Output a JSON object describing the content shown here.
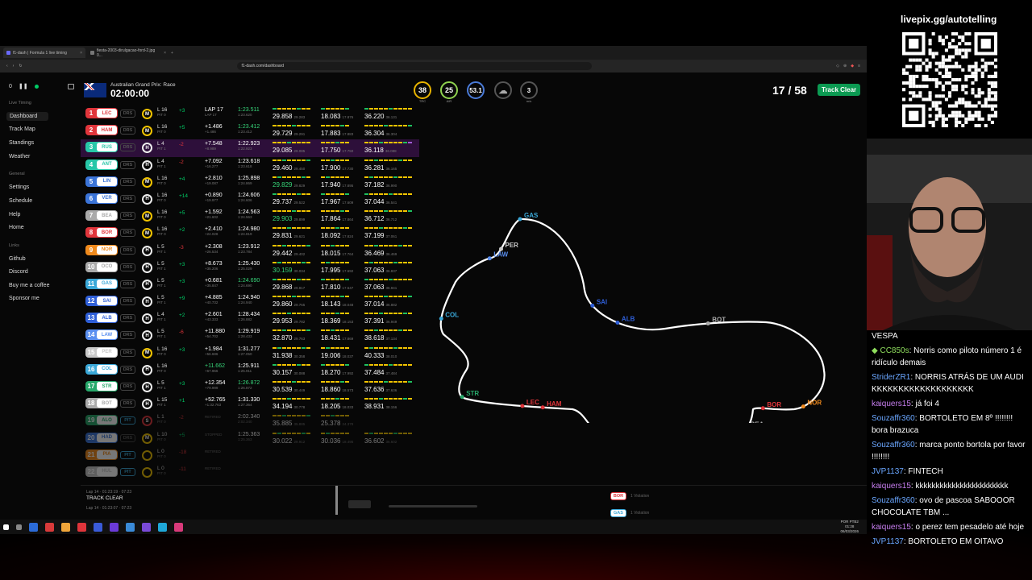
{
  "browser": {
    "tabs": [
      {
        "label": "f1-dash | Formula 1 live timing"
      },
      {
        "label": "fiesta-2003-dirulgacao-ford-2.jpg 0..."
      }
    ],
    "url": "f1-dash.com/dashboard"
  },
  "sidebar": {
    "counter": "0",
    "group_live": "Live Timing",
    "items_live": [
      {
        "label": "Dashboard"
      },
      {
        "label": "Track Map"
      },
      {
        "label": "Standings"
      },
      {
        "label": "Weather"
      }
    ],
    "group_general": "General",
    "items_general": [
      {
        "label": "Settings"
      },
      {
        "label": "Schedule"
      },
      {
        "label": "Help"
      },
      {
        "label": "Home"
      }
    ],
    "group_links": "Links",
    "items_links": [
      {
        "label": "Github"
      },
      {
        "label": "Discord"
      },
      {
        "label": "Buy me a coffee"
      },
      {
        "label": "Sponsor me"
      }
    ]
  },
  "header": {
    "gp_name": "Australian Grand Prix: Race",
    "clock": "02:00:00",
    "weather": [
      {
        "value": "38",
        "unit": "TRC",
        "color": "#e8b400"
      },
      {
        "value": "25",
        "unit": "AIR",
        "color": "#8fd14f"
      },
      {
        "value": "53.1",
        "unit": "",
        "color": "#4a7bd8"
      }
    ],
    "wind": "3",
    "wind_unit": "m/s",
    "lap_counter": "17 / 58",
    "track_status": "Track Clear"
  },
  "drivers": [
    {
      "pos": "1",
      "tla": "LEC",
      "color": "#e0353b",
      "drs": "DRS",
      "tyre": "M",
      "tc": "m",
      "laps": "L 16",
      "pit": "PIT 0",
      "pm": "+3",
      "gap": "LAP 17",
      "gapsub": "LAP 17",
      "lt": "1:23.511",
      "ltsub": "1:23.620",
      "ltg": "g",
      "s1": "29.858",
      "s1s": "29.283",
      "s2": "18.083",
      "s2s": "17.876",
      "s3": "36.220",
      "s3s": "36.131",
      "hl": false,
      "dim": false
    },
    {
      "pos": "2",
      "tla": "HAM",
      "color": "#e0353b",
      "drs": "DRS",
      "tyre": "M",
      "tc": "m",
      "laps": "L 16",
      "pit": "PIT 0",
      "pm": "+5",
      "gap": "+1.486",
      "gapsub": "+1.486",
      "lt": "1:23.412",
      "ltsub": "1:23.412",
      "ltg": "g",
      "s1": "29.729",
      "s1s": "29.291",
      "s2": "17.883",
      "s2s": "17.883",
      "s3": "36.304",
      "s3s": "36.304",
      "hl": false,
      "dim": false
    },
    {
      "pos": "3",
      "tla": "RUS",
      "color": "#27c7a8",
      "drs": "DRS",
      "tyre": "H",
      "tc": "h",
      "laps": "L 4",
      "pit": "PIT 1",
      "pm": "-2",
      "gap": "+7.548",
      "gapsub": "+8.989",
      "lt": "1:22.923",
      "ltsub": "1:22.923",
      "ltg": "",
      "s1": "29.085",
      "s1s": "29.085",
      "s2": "17.750",
      "s2s": "17.750",
      "s3": "36.118",
      "s3s": "36.088",
      "hl": true,
      "dim": false
    },
    {
      "pos": "4",
      "tla": "ANT",
      "color": "#27c7a8",
      "drs": "DRS",
      "tyre": "H",
      "tc": "h",
      "laps": "L 4",
      "pit": "PIT 1",
      "pm": "-2",
      "gap": "+7.092",
      "gapsub": "+16.277",
      "lt": "1:23.618",
      "ltsub": "1:23.618",
      "ltg": "",
      "s1": "29.460",
      "s1s": "29.450",
      "s2": "17.900",
      "s2s": "17.730",
      "s3": "36.281",
      "s3s": "36.165",
      "hl": false,
      "dim": false
    },
    {
      "pos": "5",
      "tla": "LIN",
      "color": "#3b74d8",
      "drs": "DRS",
      "tyre": "M",
      "tc": "m",
      "laps": "L 16",
      "pit": "PIT 0",
      "pm": "+4",
      "gap": "+2.810",
      "gapsub": "+19.087",
      "lt": "1:25.898",
      "ltsub": "1:24.869",
      "ltg": "",
      "s1": "29.829",
      "s1s": "29.829",
      "s2": "17.940",
      "s2s": "17.895",
      "s3": "37.182",
      "s3s": "36.990",
      "hl": false,
      "dim": false
    },
    {
      "pos": "6",
      "tla": "VER",
      "color": "#3b74d8",
      "drs": "DRS",
      "tyre": "H",
      "tc": "h",
      "laps": "L 16",
      "pit": "PIT 0",
      "pm": "+14",
      "gap": "+0.890",
      "gapsub": "+19.977",
      "lt": "1:24.606",
      "ltsub": "1:24.606",
      "ltg": "",
      "s1": "29.737",
      "s1s": "29.522",
      "s2": "17.967",
      "s2s": "17.609",
      "s3": "37.044",
      "s3s": "36.541",
      "hl": false,
      "dim": false
    },
    {
      "pos": "7",
      "tla": "BEA",
      "color": "#aaaaaa",
      "drs": "DRS",
      "tyre": "M",
      "tc": "m",
      "laps": "L 16",
      "pit": "PIT 0",
      "pm": "+5",
      "gap": "+1.592",
      "gapsub": "+21.602",
      "lt": "1:24.563",
      "ltsub": "1:24.563",
      "ltg": "",
      "s1": "29.903",
      "s1s": "29.899",
      "s2": "17.864",
      "s2s": "17.864",
      "s3": "36.712",
      "s3s": "36.712",
      "hl": false,
      "dim": false
    },
    {
      "pos": "8",
      "tla": "BOR",
      "color": "#e0353b",
      "drs": "DRS",
      "tyre": "M",
      "tc": "m",
      "laps": "L 16",
      "pit": "PIT 0",
      "pm": "+2",
      "gap": "+2.410",
      "gapsub": "+24.028",
      "lt": "1:24.980",
      "ltsub": "1:24.819",
      "ltg": "",
      "s1": "29.831",
      "s1s": "29.621",
      "s2": "18.092",
      "s2s": "17.824",
      "s3": "37.199",
      "s3s": "37.061",
      "hl": false,
      "dim": false
    },
    {
      "pos": "9",
      "tla": "NOR",
      "color": "#f08a1c",
      "drs": "DRS",
      "tyre": "H",
      "tc": "h",
      "laps": "L 5",
      "pit": "PIT 1",
      "pm": "-3",
      "gap": "+2.308",
      "gapsub": "+26.534",
      "lt": "1:23.912",
      "ltsub": "1:23.784",
      "ltg": "",
      "s1": "29.442",
      "s1s": "29.402",
      "s2": "18.015",
      "s2s": "17.764",
      "s3": "36.469",
      "s3s": "36.469",
      "hl": false,
      "dim": false
    },
    {
      "pos": "10",
      "tla": "OCO",
      "color": "#aaaaaa",
      "drs": "DRS",
      "tyre": "H",
      "tc": "h",
      "laps": "L 5",
      "pit": "PIT 1",
      "pm": "+3",
      "gap": "+8.673",
      "gapsub": "+35.206",
      "lt": "1:25.430",
      "ltsub": "1:25.029",
      "ltg": "",
      "s1": "30.159",
      "s1s": "30.034",
      "s2": "17.995",
      "s2s": "17.692",
      "s3": "37.063",
      "s3s": "36.837",
      "hl": false,
      "dim": false
    },
    {
      "pos": "11",
      "tla": "GAS",
      "color": "#3aa8d8",
      "drs": "DRS",
      "tyre": "H",
      "tc": "h",
      "laps": "L 5",
      "pit": "PIT 1",
      "pm": "+3",
      "gap": "+0.681",
      "gapsub": "+35.847",
      "lt": "1:24.690",
      "ltsub": "1:24.690",
      "ltg": "g",
      "s1": "29.868",
      "s1s": "29.817",
      "s2": "17.810",
      "s2s": "17.647",
      "s3": "37.063",
      "s3s": "36.941",
      "hl": false,
      "dim": false
    },
    {
      "pos": "12",
      "tla": "SAI",
      "color": "#2f5fd8",
      "drs": "DRS",
      "tyre": "H",
      "tc": "h",
      "laps": "L 5",
      "pit": "PIT 1",
      "pm": "+9",
      "gap": "+4.885",
      "gapsub": "+40.732",
      "lt": "1:24.940",
      "ltsub": "1:24.940",
      "ltg": "",
      "s1": "29.860",
      "s1s": "29.765",
      "s2": "18.143",
      "s2s": "18.048",
      "s3": "37.014",
      "s3s": "36.882",
      "hl": false,
      "dim": false
    },
    {
      "pos": "13",
      "tla": "ALB",
      "color": "#2f5fd8",
      "drs": "DRS",
      "tyre": "H",
      "tc": "h",
      "laps": "L 4",
      "pit": "PIT 1",
      "pm": "+2",
      "gap": "+2.601",
      "gapsub": "+43.333",
      "lt": "1:28.434",
      "ltsub": "1:26.882",
      "ltg": "",
      "s1": "29.953",
      "s1s": "29.782",
      "s2": "18.369",
      "s2s": "18.153",
      "s3": "37.391",
      "s3s": "36.949",
      "hl": false,
      "dim": false
    },
    {
      "pos": "14",
      "tla": "LAW",
      "color": "#5a8ff0",
      "drs": "DRS",
      "tyre": "H",
      "tc": "h",
      "laps": "L 5",
      "pit": "PIT 1",
      "pm": "-6",
      "gap": "+11.880",
      "gapsub": "+54.702",
      "lt": "1:29.919",
      "ltsub": "1:28.433",
      "ltg": "",
      "s1": "32.870",
      "s1s": "29.763",
      "s2": "18.431",
      "s2s": "17.869",
      "s3": "38.618",
      "s3s": "37.134",
      "hl": false,
      "dim": false
    },
    {
      "pos": "15",
      "tla": "PER",
      "color": "#c8c8c8",
      "drs": "DRS",
      "tyre": "M",
      "tc": "m",
      "laps": "L 16",
      "pit": "PIT 0",
      "pm": "+3",
      "gap": "+1.984",
      "gapsub": "+56.686",
      "lt": "1:31.277",
      "ltsub": "1:27.050",
      "ltg": "",
      "s1": "31.938",
      "s1s": "30.358",
      "s2": "19.006",
      "s2s": "18.037",
      "s3": "40.333",
      "s3s": "38.010",
      "hl": false,
      "dim": false
    },
    {
      "pos": "16",
      "tla": "COL",
      "color": "#3aa8d8",
      "drs": "DRS",
      "tyre": "H",
      "tc": "h",
      "laps": "L 16",
      "pit": "PIT 0",
      "pm": "",
      "gap": "+11.662",
      "gapsub": "+67.966",
      "lt": "1:25.911",
      "ltsub": "1:25.911",
      "ltg": "",
      "s1": "30.157",
      "s1s": "30.088",
      "s2": "18.270",
      "s2s": "17.992",
      "s3": "37.484",
      "s3s": "37.484",
      "hl": false,
      "dim": false
    },
    {
      "pos": "17",
      "tla": "STR",
      "color": "#27a86a",
      "drs": "DRS",
      "tyre": "H",
      "tc": "h",
      "laps": "L 5",
      "pit": "PIT 1",
      "pm": "+3",
      "gap": "+12.354",
      "gapsub": "+79.999",
      "lt": "1:26.872",
      "ltsub": "1:26.872",
      "ltg": "g",
      "s1": "30.539",
      "s1s": "30.449",
      "s2": "18.860",
      "s2s": "18.573",
      "s3": "37.636",
      "s3s": "37.636",
      "hl": false,
      "dim": false
    },
    {
      "pos": "18",
      "tla": "BOT",
      "color": "#aaaaaa",
      "drs": "DRS",
      "tyre": "H",
      "tc": "h",
      "laps": "L 15",
      "pit": "PIT 1",
      "pm": "+1",
      "gap": "+52.765",
      "gapsub": "+1:32.763",
      "lt": "1:31.330",
      "ltsub": "1:27.364",
      "ltg": "",
      "s1": "34.194",
      "s1s": "30.778",
      "s2": "18.205",
      "s2s": "18.033",
      "s3": "38.931",
      "s3s": "38.156",
      "hl": false,
      "dim": false
    },
    {
      "pos": "19",
      "tla": "ALO",
      "color": "#27a86a",
      "drs": "PIT",
      "tyre": "S",
      "tc": "s",
      "laps": "L 1",
      "pit": "PIT 0",
      "pm": "-2",
      "gap": "",
      "gapsub": "RETIRED",
      "lt": "2:02.340",
      "ltsub": "2:02.340",
      "ltg": "",
      "s1": "35.885",
      "s1s": "35.885",
      "s2": "25.378",
      "s2s": "24.378",
      "s3": "",
      "s3s": "",
      "hl": false,
      "dim": true
    },
    {
      "pos": "20",
      "tla": "HAD",
      "color": "#3b74d8",
      "drs": "DRS",
      "tyre": "M",
      "tc": "m",
      "laps": "L 10",
      "pit": "PIT 0",
      "pm": "+5",
      "gap": "",
      "gapsub": "STOPPED",
      "lt": "1:25.363",
      "ltsub": "1:25.363",
      "ltg": "",
      "s1": "30.022",
      "s1s": "29.912",
      "s2": "30.036",
      "s2s": "18.495",
      "s3": "36.602",
      "s3s": "36.602",
      "hl": false,
      "dim": true
    },
    {
      "pos": "21",
      "tla": "PIA",
      "color": "#f08a1c",
      "drs": "PIT",
      "tyre": "",
      "tc": "m",
      "laps": "L 0",
      "pit": "PIT 0",
      "pm": "-18",
      "gap": "",
      "gapsub": "RETIRED",
      "lt": "",
      "ltsub": "",
      "ltg": "",
      "s1": "",
      "s1s": "",
      "s2": "",
      "s2s": "",
      "s3": "",
      "s3s": "",
      "hl": false,
      "dim": true
    },
    {
      "pos": "22",
      "tla": "HUL",
      "color": "#c8c8c8",
      "drs": "PIT",
      "tyre": "",
      "tc": "m",
      "laps": "L 0",
      "pit": "PIT 0",
      "pm": "-11",
      "gap": "",
      "gapsub": "RETIRED",
      "lt": "",
      "ltsub": "",
      "ltg": "",
      "s1": "",
      "s1s": "",
      "s2": "",
      "s2s": "",
      "s3": "",
      "s3s": "",
      "hl": false,
      "dim": true
    }
  ],
  "track_map": {
    "labels": [
      {
        "tla": "GAS",
        "color": "#3aa8d8"
      },
      {
        "tla": "SAI",
        "color": "#2f5fd8"
      },
      {
        "tla": "ALB",
        "color": "#2f5fd8"
      },
      {
        "tla": "BOT",
        "color": "#aaaaaa"
      },
      {
        "tla": "NOR",
        "color": "#f08a1c"
      },
      {
        "tla": "BOR",
        "color": "#e0353b"
      },
      {
        "tla": "BEA",
        "color": "#aaaaaa"
      },
      {
        "tla": "LIN",
        "color": "#3b74d8"
      },
      {
        "tla": "ANT",
        "color": "#27c7a8"
      },
      {
        "tla": "RUS",
        "color": "#27c7a8"
      },
      {
        "tla": "HAM",
        "color": "#e0353b"
      },
      {
        "tla": "LEC",
        "color": "#e0353b"
      },
      {
        "tla": "STR",
        "color": "#27a86a"
      },
      {
        "tla": "COL",
        "color": "#3aa8d8"
      },
      {
        "tla": "LAW",
        "color": "#5a8ff0"
      },
      {
        "tla": "PER",
        "color": "#c8c8c8"
      }
    ]
  },
  "race_control": {
    "line1": "Lap 14 · 01:23:19 · 07:23",
    "message": "TRACK CLEAR",
    "line2": "Lap 14 · 01:23:07 · 07:23"
  },
  "violations": [
    {
      "tla": "BOR",
      "color": "#e0353b",
      "label": "1 Violation"
    },
    {
      "tla": "GAS",
      "color": "#3aa8d8",
      "label": "1 Violation"
    }
  ],
  "taskbar": {
    "lang": "POR PTB2",
    "time": "01:28",
    "date": "06/03/2026"
  },
  "stream": {
    "qr_title": "livepix.gg/autotelling",
    "chat": [
      {
        "user": "",
        "text": "VESPA",
        "uc": ""
      },
      {
        "user": "CC850s",
        "text": ": Norris como piloto número 1 é ridículo demais",
        "uc": "gr"
      },
      {
        "user": "StriderZR1",
        "text": ": NORRIS ATRÁS DE UM AUDI KKKKKKKKKKKKKKKKKKK",
        "uc": "b"
      },
      {
        "user": "kaiquers15",
        "text": ": já foi 4",
        "uc": ""
      },
      {
        "user": "Souzaffr360",
        "text": ": BORTOLETO EM 8º !!!!!!!! bora brazuca",
        "uc": "b"
      },
      {
        "user": "Souzaffr360",
        "text": ": marca ponto bortola por favor !!!!!!!!",
        "uc": "b"
      },
      {
        "user": "JVP1137",
        "text": ": FINTECH",
        "uc": "b"
      },
      {
        "user": "kaiquers15",
        "text": ": kkkkkkkkkkkkkkkkkkkkkkk",
        "uc": ""
      },
      {
        "user": "Souzaffr360",
        "text": ": ovo de pascoa SABOOOR CHOCOLATE TBM ...",
        "uc": "b"
      },
      {
        "user": "kaiquers15",
        "text": ": o perez tem pesadelo até hoje",
        "uc": ""
      },
      {
        "user": "JVP1137",
        "text": ": BORTOLETO EM OITAVO",
        "uc": "b"
      }
    ]
  }
}
